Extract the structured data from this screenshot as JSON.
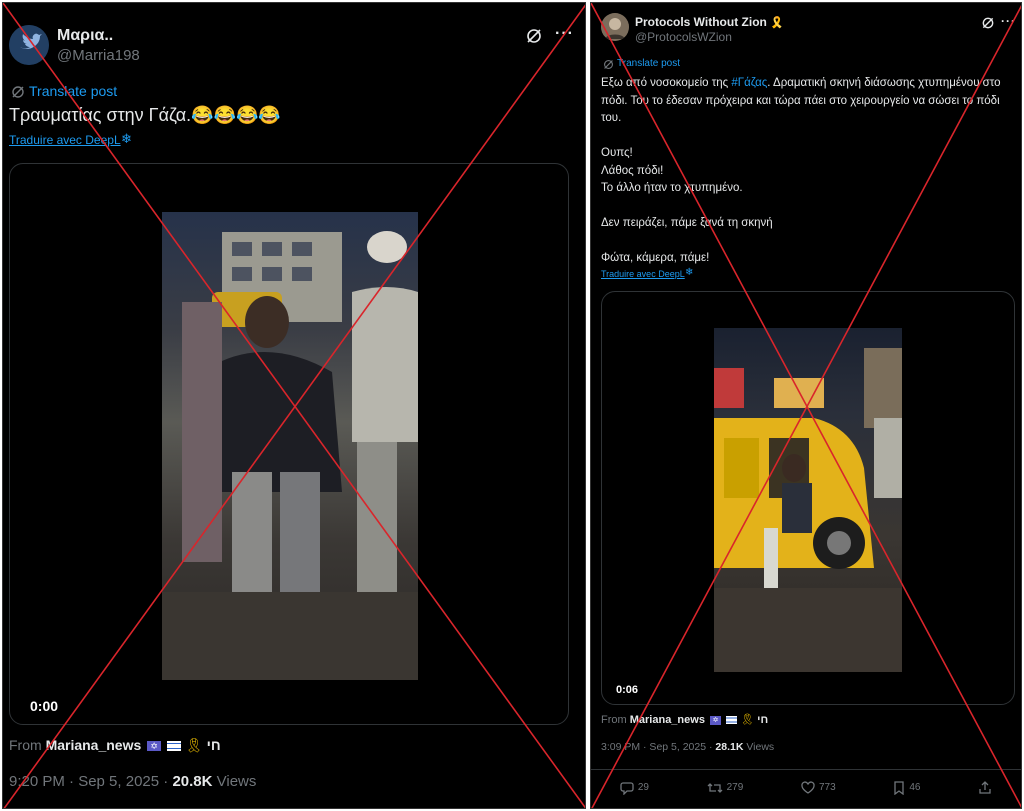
{
  "left": {
    "author_name": "Μαρια..",
    "handle": "@Marria198",
    "translate_label": "Translate post",
    "text": "Τραυματίας στην Γάζα.😂😂😂😂",
    "deepl_label": "Traduire avec DeepL",
    "video_time": "0:00",
    "from_prefix": "From",
    "from_account": "Mariana_news",
    "from_suffix": "חי",
    "timestamp": "9:20 PM · Sep 5, 2025 · ",
    "views_count": "20.8K",
    "views_label": " Views"
  },
  "right": {
    "author_name": "Protocols Without Zion",
    "ribbon": "🎗️",
    "handle": "@ProtocolsWZion",
    "translate_label": "Translate post",
    "text_before": "Εξω από νοσοκομείο της ",
    "hashtag": "#Γάζας",
    "text_after": ". Δραματική σκηνή διάσωσης χτυπημένου στο πόδι. Του το έδεσαν πρόχειρα και τώρα πάει στο χειρουργείο να σώσει το πόδι του.\n\nΟυπς!\nΛάθος πόδι!\nΤο άλλο ήταν το χτυπημένο.\n\nΔεν πειράζει, πάμε ξανά τη σκηνή\n\nΦώτα, κάμερα, πάμε!",
    "deepl_label": "Traduire avec DeepL",
    "video_time": "0:06",
    "from_prefix": "From",
    "from_account": "Mariana_news",
    "from_suffix": "חי",
    "timestamp": "3:09 PM · Sep 5, 2025 · ",
    "views_count": "28.1K",
    "views_label": " Views",
    "replies": "29",
    "reposts": "279",
    "likes": "773",
    "bookmarks": "46"
  },
  "colors": {
    "background": "#000000",
    "link": "#1d9bf0",
    "muted": "#71767b",
    "cross": "#d9252b"
  }
}
